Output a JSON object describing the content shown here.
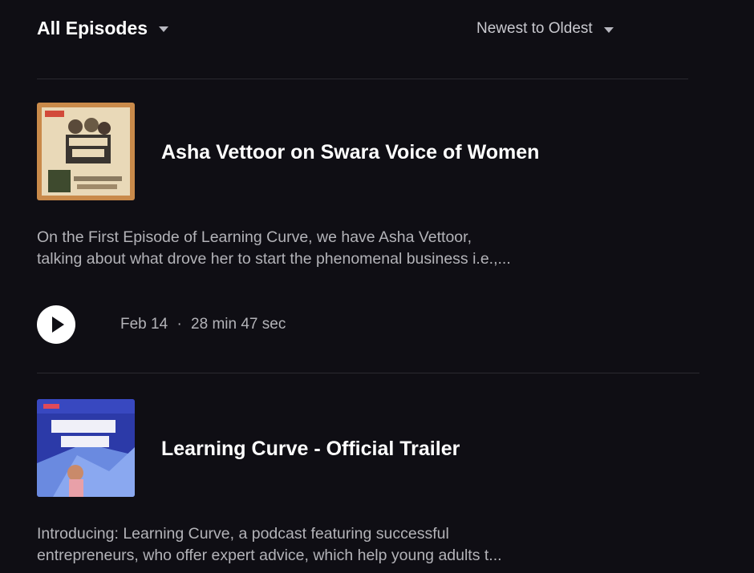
{
  "header": {
    "filter_label": "All Episodes",
    "sort_label": "Newest to Oldest"
  },
  "episodes": [
    {
      "title": "Asha Vettoor on Swara Voice of Women",
      "description_line1": "On the First Episode of Learning Curve, we have Asha Vettoor,",
      "description_line2": "talking about what drove her to start the phenomenal business i.e.,...",
      "date": "Feb 14",
      "separator": "·",
      "duration": "28 min 47 sec",
      "cover_icon": "podcast-cover-learning-curve-guest"
    },
    {
      "title": "Learning Curve - Official Trailer",
      "description_line1": "Introducing: Learning Curve, a podcast featuring successful",
      "description_line2": "entrepreneurs, who offer expert advice, which help young adults t...",
      "cover_icon": "podcast-cover-learning-curve-trailer"
    }
  ],
  "colors": {
    "background": "#0f0e14",
    "primary_text": "#ffffff",
    "secondary_text": "#b3b3b8",
    "divider": "#2a2930"
  }
}
